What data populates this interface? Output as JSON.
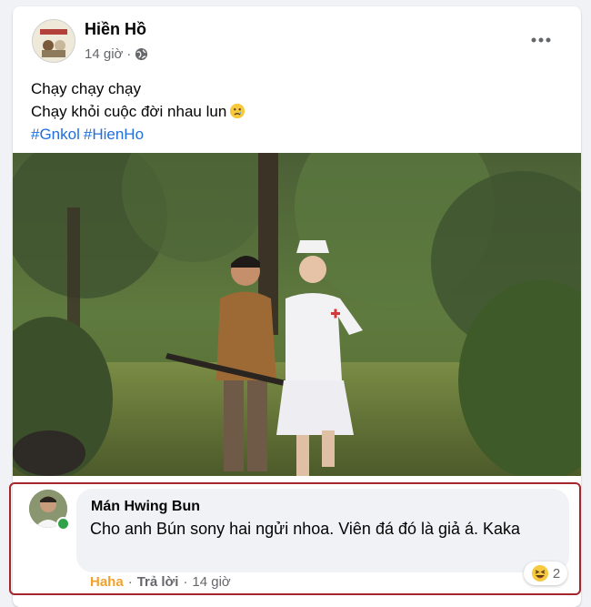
{
  "post": {
    "author": "Hiền Hồ",
    "time": "14 giờ",
    "separator": "·",
    "privacy_icon": "globe-icon",
    "more_icon": "more-horizontal-icon",
    "caption_line1": "Chạy chạy chạy",
    "caption_line2": "Chạy khỏi cuộc đời nhau lun",
    "caption_emoji": "sad-face-emoji",
    "hashtags": [
      "#Gnkol",
      "#HienHo"
    ]
  },
  "comment": {
    "author": "Mán Hwing Bun",
    "text": "Cho anh Bún sony hai ngửi nhoa. Viên đá đó là giả á. Kaka",
    "reaction_label": "Haha",
    "dot": "·",
    "reply_label": "Trả lời",
    "time": "14 giờ",
    "reaction_icon": "haha-emoji",
    "reaction_count": "2",
    "highlight_color": "#a3272d",
    "online_color": "#31a24c"
  },
  "colors": {
    "background": "#f0f2f5",
    "link_blue": "#216fdb",
    "haha_orange": "#f2a12c",
    "meta_gray": "#65676b"
  }
}
